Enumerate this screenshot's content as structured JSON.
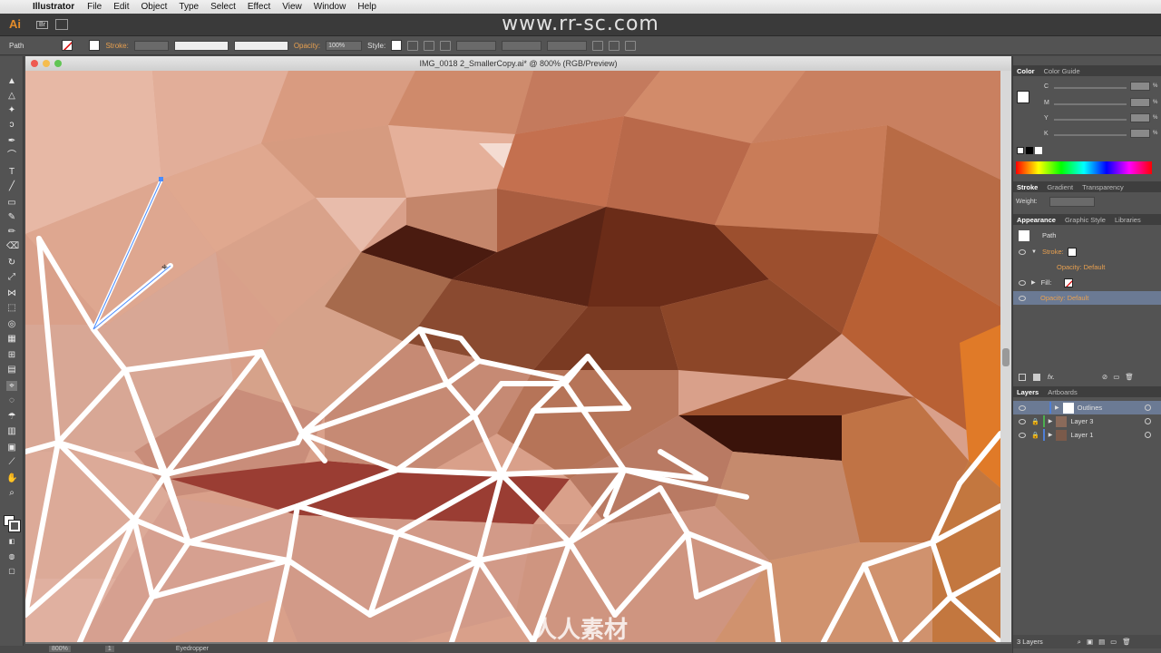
{
  "menubar": {
    "app_name": "Illustrator",
    "items": [
      "File",
      "Edit",
      "Object",
      "Type",
      "Select",
      "Effect",
      "View",
      "Window",
      "Help"
    ]
  },
  "watermark": {
    "top_text": "www.rr-sc.com",
    "bottom_text": "人人素材"
  },
  "appbar": {
    "logo": "Ai",
    "badge": "Br"
  },
  "control_bar": {
    "object_type": "Path",
    "stroke_label": "Stroke:",
    "opacity_label": "Opacity:",
    "opacity_value": "100%",
    "style_label": "Style:"
  },
  "document": {
    "title": "IMG_0018 2_SmallerCopy.ai* @ 800% (RGB/Preview)",
    "zoom": "800%",
    "artboard_nav": "1",
    "status_tool": "Eyedropper"
  },
  "color_panel": {
    "tabs": [
      "Color",
      "Color Guide"
    ],
    "channels": [
      "C",
      "M",
      "Y",
      "K"
    ],
    "unit": "%"
  },
  "stroke_panel": {
    "tabs": [
      "Stroke",
      "Gradient",
      "Transparency"
    ],
    "weight_label": "Weight:"
  },
  "appearance_panel": {
    "tabs": [
      "Appearance",
      "Graphic Style",
      "Libraries"
    ],
    "header": "Path",
    "rows": [
      {
        "label": "Stroke:",
        "sub": ""
      },
      {
        "label": "Opacity: Default",
        "sub": ""
      },
      {
        "label": "Fill:",
        "sub": ""
      },
      {
        "label": "Opacity: Default",
        "sub": ""
      }
    ],
    "fx_label": "fx."
  },
  "layers_panel": {
    "tabs": [
      "Layers",
      "Artboards"
    ],
    "layers": [
      "Outlines",
      "Layer 3",
      "Layer 1"
    ],
    "count_label": "3 Layers"
  },
  "colors": {
    "selection_blue": "#6b7a94",
    "layer_blue": "#4f7fd6",
    "layer_green": "#4caf50",
    "accent_orange": "#e8a050"
  }
}
